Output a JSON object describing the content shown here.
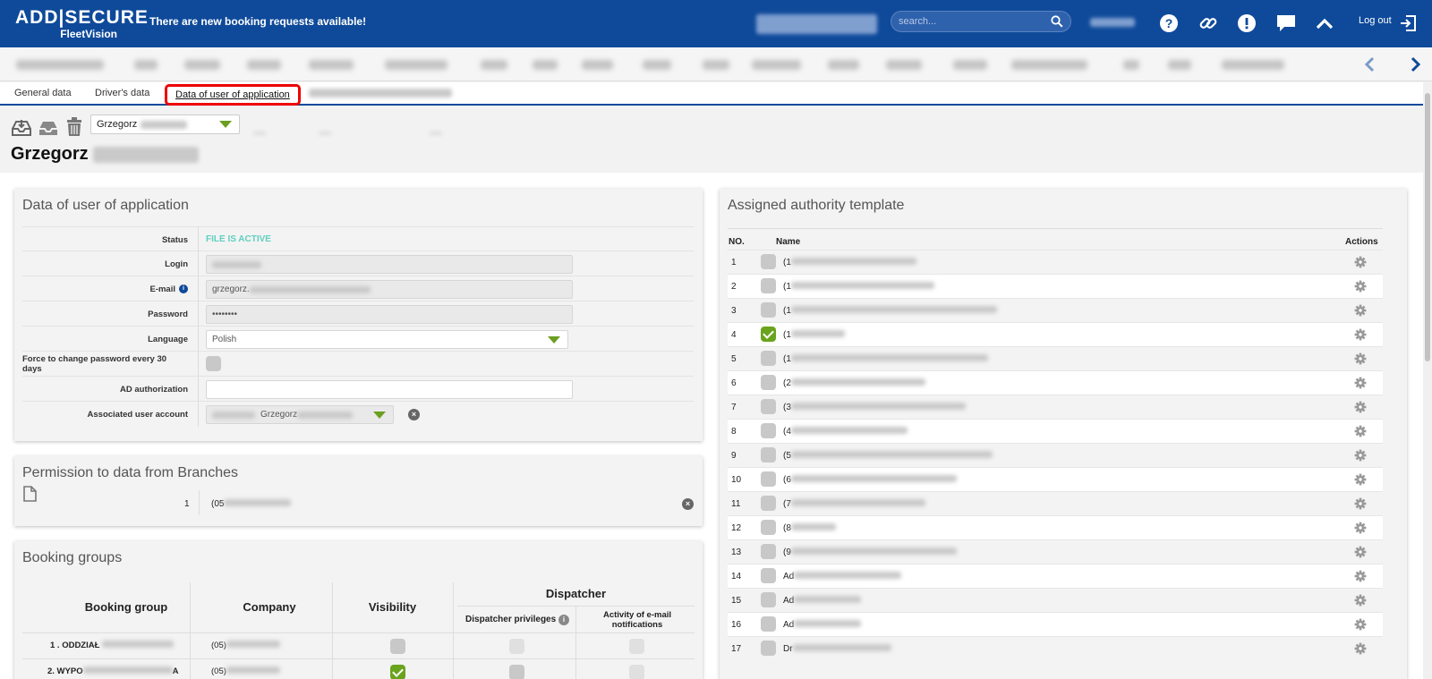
{
  "header": {
    "logo_main": "ADD|SECURE",
    "logo_sub": "FleetVision",
    "notice": "There are new booking requests available!",
    "search_placeholder": "search...",
    "logout_label": "Log out"
  },
  "tabs": [
    {
      "label": "General data"
    },
    {
      "label": "Driver's data"
    },
    {
      "label": "Data of user of application",
      "active": true
    }
  ],
  "toolbar": {
    "user_select_value": "Grzegorz",
    "page_name": "Grzegorz"
  },
  "user_panel": {
    "title": "Data of user of application",
    "fields": {
      "status_label": "Status",
      "status_value": "FILE IS ACTIVE",
      "login_label": "Login",
      "email_label": "E-mail",
      "email_value": "grzegorz.",
      "password_label": "Password",
      "password_value": "••••••••",
      "language_label": "Language",
      "language_value": "Polish",
      "force_label": "Force to change password every 30 days",
      "ad_label": "AD authorization",
      "assoc_label": "Associated user account",
      "assoc_value": "Grzegorz"
    },
    "status_color": "#5fd0c0"
  },
  "branches_panel": {
    "title": "Permission to data from Branches",
    "row_no": "1",
    "row_value": "(05"
  },
  "booking_panel": {
    "title": "Booking groups",
    "col_group": "Booking group",
    "col_company": "Company",
    "col_visibility": "Visibility",
    "col_dispatcher": "Dispatcher",
    "col_privileges": "Dispatcher privileges",
    "col_notifications": "Activity of e-mail notifications",
    "rows": [
      {
        "group": "1 . ODDZIAŁ ",
        "company": "(05)",
        "visible": false
      },
      {
        "group": "2. WYPO",
        "group_suffix": "A",
        "company": "(05)",
        "visible": true
      }
    ]
  },
  "authority_panel": {
    "title": "Assigned authority template",
    "col_no": "NO.",
    "col_name": "Name",
    "col_actions": "Actions",
    "rows": [
      {
        "no": "1",
        "prefix": "(1",
        "checked": false
      },
      {
        "no": "2",
        "prefix": "(1",
        "checked": false
      },
      {
        "no": "3",
        "prefix": "(1",
        "checked": false
      },
      {
        "no": "4",
        "prefix": "(1",
        "checked": true
      },
      {
        "no": "5",
        "prefix": "(1",
        "checked": false
      },
      {
        "no": "6",
        "prefix": "(2",
        "checked": false
      },
      {
        "no": "7",
        "prefix": "(3",
        "checked": false
      },
      {
        "no": "8",
        "prefix": "(4",
        "checked": false
      },
      {
        "no": "9",
        "prefix": "(5",
        "checked": false
      },
      {
        "no": "10",
        "prefix": "(6",
        "checked": false
      },
      {
        "no": "11",
        "prefix": "(7",
        "checked": false
      },
      {
        "no": "12",
        "prefix": "(8",
        "checked": false
      },
      {
        "no": "13",
        "prefix": "(9",
        "checked": false
      },
      {
        "no": "14",
        "prefix": "Ad",
        "checked": false
      },
      {
        "no": "15",
        "prefix": "Ad",
        "checked": false
      },
      {
        "no": "16",
        "prefix": "Ad",
        "checked": false
      },
      {
        "no": "17",
        "prefix": "Dr",
        "checked": false
      }
    ]
  },
  "colors": {
    "brand": "#0f4a9a",
    "accent_green": "#6aa31d",
    "highlight": "#e00000"
  }
}
